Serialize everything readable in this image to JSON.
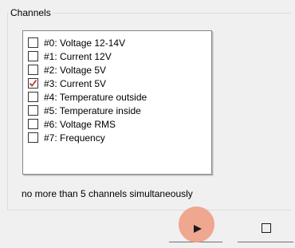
{
  "channels_group": {
    "title": "Channels",
    "items": [
      {
        "label": "#0: Voltage 12-14V",
        "checked": false
      },
      {
        "label": "#1: Current 12V",
        "checked": false
      },
      {
        "label": "#2: Voltage 5V",
        "checked": false
      },
      {
        "label": "#3: Current 5V",
        "checked": true
      },
      {
        "label": "#4: Temperature outside",
        "checked": false
      },
      {
        "label": "#5: Temperature inside",
        "checked": false
      },
      {
        "label": "#6: Voltage RMS",
        "checked": false
      },
      {
        "label": "#7: Frequency",
        "checked": false
      }
    ],
    "note": "no more than 5 channels simultaneously"
  },
  "toolbar": {
    "start_icon": "play-icon",
    "stop_icon": "stop-square-icon"
  },
  "colors": {
    "checkmark": "#c0392b",
    "click_highlight": "#eea28a"
  }
}
